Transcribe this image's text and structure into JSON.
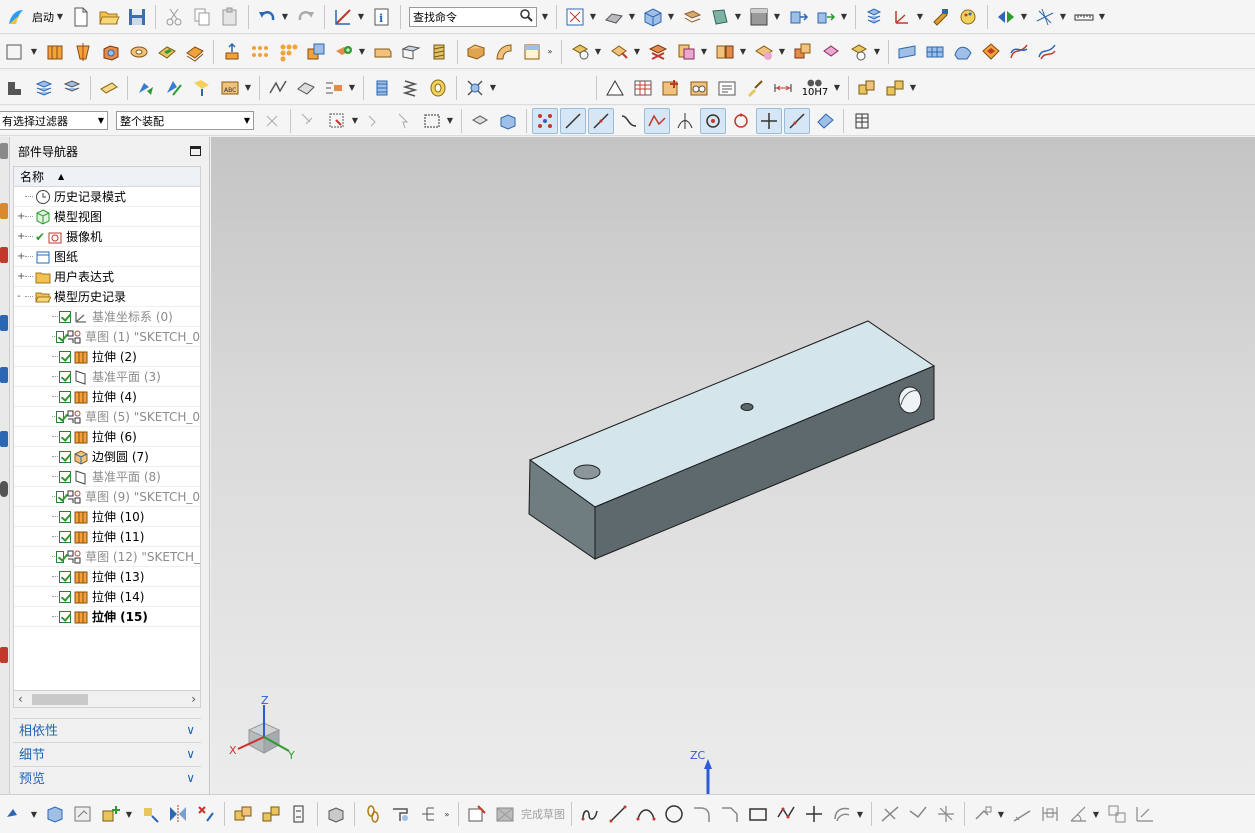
{
  "toolbar": {
    "start_label": "启动",
    "search_placeholder": "查找命令",
    "filter_combo": "有选择过滤器",
    "assembly_combo": "整个装配",
    "tolerance_label": "10H7"
  },
  "navigator": {
    "title": "部件导航器",
    "column_name": "名称",
    "items": [
      {
        "label": "历史记录模式",
        "level": 0,
        "expander": "",
        "icon": "clock-icon",
        "checked": false,
        "gray": false
      },
      {
        "label": "模型视图",
        "level": 0,
        "expander": "+",
        "icon": "model-view-icon",
        "checked": false,
        "gray": false
      },
      {
        "label": "摄像机",
        "level": 0,
        "expander": "+",
        "icon": "camera-icon",
        "checked": true,
        "gray": false
      },
      {
        "label": "图纸",
        "level": 0,
        "expander": "+",
        "icon": "drawing-icon",
        "checked": false,
        "gray": false
      },
      {
        "label": "用户表达式",
        "level": 0,
        "expander": "+",
        "icon": "folder-icon",
        "checked": false,
        "gray": false
      },
      {
        "label": "模型历史记录",
        "level": 0,
        "expander": "-",
        "icon": "folder-open-icon",
        "checked": false,
        "gray": false
      },
      {
        "label": "基准坐标系 (0)",
        "level": 1,
        "icon": "datum-csys-icon",
        "checked": true,
        "gray": true
      },
      {
        "label": "草图 (1) \"SKETCH_0",
        "level": 1,
        "icon": "sketch-icon",
        "checked": true,
        "gray": true
      },
      {
        "label": "拉伸 (2)",
        "level": 1,
        "icon": "extrude-icon",
        "checked": true,
        "gray": false
      },
      {
        "label": "基准平面 (3)",
        "level": 1,
        "icon": "datum-plane-icon",
        "checked": true,
        "gray": true
      },
      {
        "label": "拉伸 (4)",
        "level": 1,
        "icon": "extrude-icon",
        "checked": true,
        "gray": false
      },
      {
        "label": "草图 (5) \"SKETCH_0",
        "level": 1,
        "icon": "sketch-icon",
        "checked": true,
        "gray": true
      },
      {
        "label": "拉伸 (6)",
        "level": 1,
        "icon": "extrude-icon",
        "checked": true,
        "gray": false
      },
      {
        "label": "边倒圆 (7)",
        "level": 1,
        "icon": "edge-blend-icon",
        "checked": true,
        "gray": false
      },
      {
        "label": "基准平面 (8)",
        "level": 1,
        "icon": "datum-plane-icon",
        "checked": true,
        "gray": true
      },
      {
        "label": "草图 (9) \"SKETCH_0",
        "level": 1,
        "icon": "sketch-icon",
        "checked": true,
        "gray": true
      },
      {
        "label": "拉伸 (10)",
        "level": 1,
        "icon": "extrude-icon",
        "checked": true,
        "gray": false
      },
      {
        "label": "拉伸 (11)",
        "level": 1,
        "icon": "extrude-icon",
        "checked": true,
        "gray": false
      },
      {
        "label": "草图 (12) \"SKETCH_",
        "level": 1,
        "icon": "sketch-icon",
        "checked": true,
        "gray": true
      },
      {
        "label": "拉伸 (13)",
        "level": 1,
        "icon": "extrude-icon",
        "checked": true,
        "gray": false
      },
      {
        "label": "拉伸 (14)",
        "level": 1,
        "icon": "extrude-icon",
        "checked": true,
        "gray": false
      },
      {
        "label": "拉伸 (15)",
        "level": 1,
        "icon": "extrude-icon",
        "checked": true,
        "gray": false,
        "selected": true
      }
    ],
    "panels": {
      "dependencies": "相依性",
      "details": "细节",
      "preview": "预览"
    }
  },
  "viewport": {
    "triad": {
      "z": "Z",
      "x": "X",
      "y": "Y"
    },
    "wcs_label": "ZC"
  },
  "bottom_toolbar": {
    "finish_sketch": "完成草图"
  },
  "colors": {
    "top_face": "#d4e6ec",
    "front_face": "#6f7c80",
    "side_face": "#5d696d",
    "accent": "#1e64b4"
  }
}
